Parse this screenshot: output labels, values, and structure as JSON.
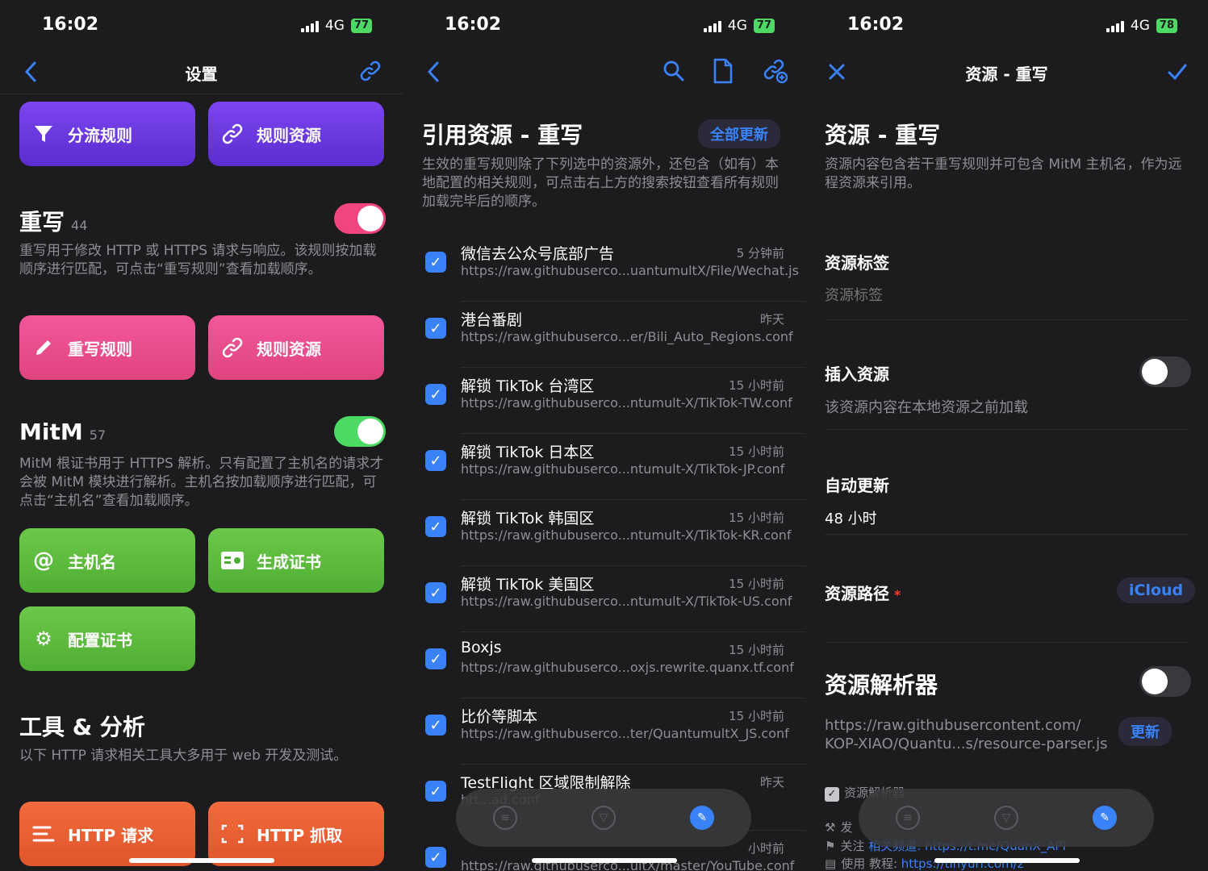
{
  "status": {
    "time": "16:02",
    "network": "4G"
  },
  "left": {
    "battery": "77",
    "nav_title": "设置",
    "top_tiles": {
      "split_rules": "分流规则",
      "rule_resources": "规则资源"
    },
    "rewrite": {
      "title": "重写",
      "count": "44",
      "desc": "重写用于修改 HTTP 或 HTTPS 请求与响应。该规则按加载顺序进行匹配，可点击“重写规则”查看加载顺序。",
      "tile_rules": "重写规则",
      "tile_resources": "规则资源"
    },
    "mitm": {
      "title": "MitM",
      "count": "57",
      "desc": "MitM 根证书用于 HTTPS 解析。只有配置了主机名的请求才会被 MitM 模块进行解析。主机名按加载顺序进行匹配，可点击“主机名”查看加载顺序。",
      "tile_hostname": "主机名",
      "tile_gen_cert": "生成证书",
      "tile_config_cert": "配置证书"
    },
    "tools": {
      "title": "工具 & 分析",
      "desc": "以下 HTTP 请求相关工具大多用于 web 开发及测试。",
      "tile_http_request": "HTTP 请求",
      "tile_http_capture": "HTTP 抓取"
    }
  },
  "middle": {
    "battery": "77",
    "header": "引用资源 - 重写",
    "update_all": "全部更新",
    "desc": "生效的重写规则除了下列选中的资源外，还包含（如有）本地配置的相关规则，可点击右上方的搜索按钮查看所有规则加载完毕后的顺序。",
    "items": [
      {
        "name": "微信去公众号底部广告",
        "time": "5 分钟前",
        "url": "https://raw.githubuserco...uantumultX/File/Wechat.js"
      },
      {
        "name": "港台番剧",
        "time": "昨天",
        "url": "https://raw.githubuserco...er/Bili_Auto_Regions.conf"
      },
      {
        "name": "解锁 TikTok 台湾区",
        "time": "15 小时前",
        "url": "https://raw.githubuserco...ntumult-X/TikTok-TW.conf"
      },
      {
        "name": "解锁 TikTok 日本区",
        "time": "15 小时前",
        "url": "https://raw.githubuserco...ntumult-X/TikTok-JP.conf"
      },
      {
        "name": "解锁 TikTok 韩国区",
        "time": "15 小时前",
        "url": "https://raw.githubuserco...ntumult-X/TikTok-KR.conf"
      },
      {
        "name": "解锁 TikTok 美国区",
        "time": "15 小时前",
        "url": "https://raw.githubuserco...ntumult-X/TikTok-US.conf"
      },
      {
        "name": "Boxjs",
        "time": "15 小时前",
        "url": "https://raw.githubuserco...oxjs.rewrite.quanx.tf.conf"
      },
      {
        "name": "比价等脚本",
        "time": "15 小时前",
        "url": "https://raw.githubuserco...ter/QuantumultX_JS.conf"
      },
      {
        "name": "TestFlight 区域限制解除",
        "time": "昨天",
        "url": "htt...ad.conf"
      },
      {
        "name": "",
        "time": "小时前",
        "url": "https://raw.githubuserco...ultX/master/YouTube.conf"
      }
    ]
  },
  "right": {
    "battery": "78",
    "nav_title": "资源 - 重写",
    "header": "资源 - 重写",
    "desc": "资源内容包含若干重写规则并可包含 MitM 主机名，作为远程资源来引用。",
    "tag_label": "资源标签",
    "tag_placeholder": "资源标签",
    "insert_label": "插入资源",
    "insert_desc": "该资源内容在本地资源之前加载",
    "auto_update_label": "自动更新",
    "auto_update_value": "48 小时",
    "path_label": "资源路径",
    "path_required": "*",
    "path_button": "iCloud",
    "parser_label": "资源解析器",
    "parser_url_line1": "https://raw.githubusercontent.com/",
    "parser_url_line2": "KOP-XIAO/Quantu...s/resource-parser.js",
    "parser_update": "更新",
    "log_line1": "资源解析器",
    "log_line2": "发",
    "log_line3": "关注",
    "log_line3b": "相关频道: https://t.me/QuanX_API",
    "log_line4": "使用 教程:",
    "log_line4b": "https://tinyurl.com/z"
  },
  "colors": {
    "accent": "#3a82f7",
    "toggle_on_pink": "#f0457f",
    "toggle_on_green": "#4cd964"
  }
}
